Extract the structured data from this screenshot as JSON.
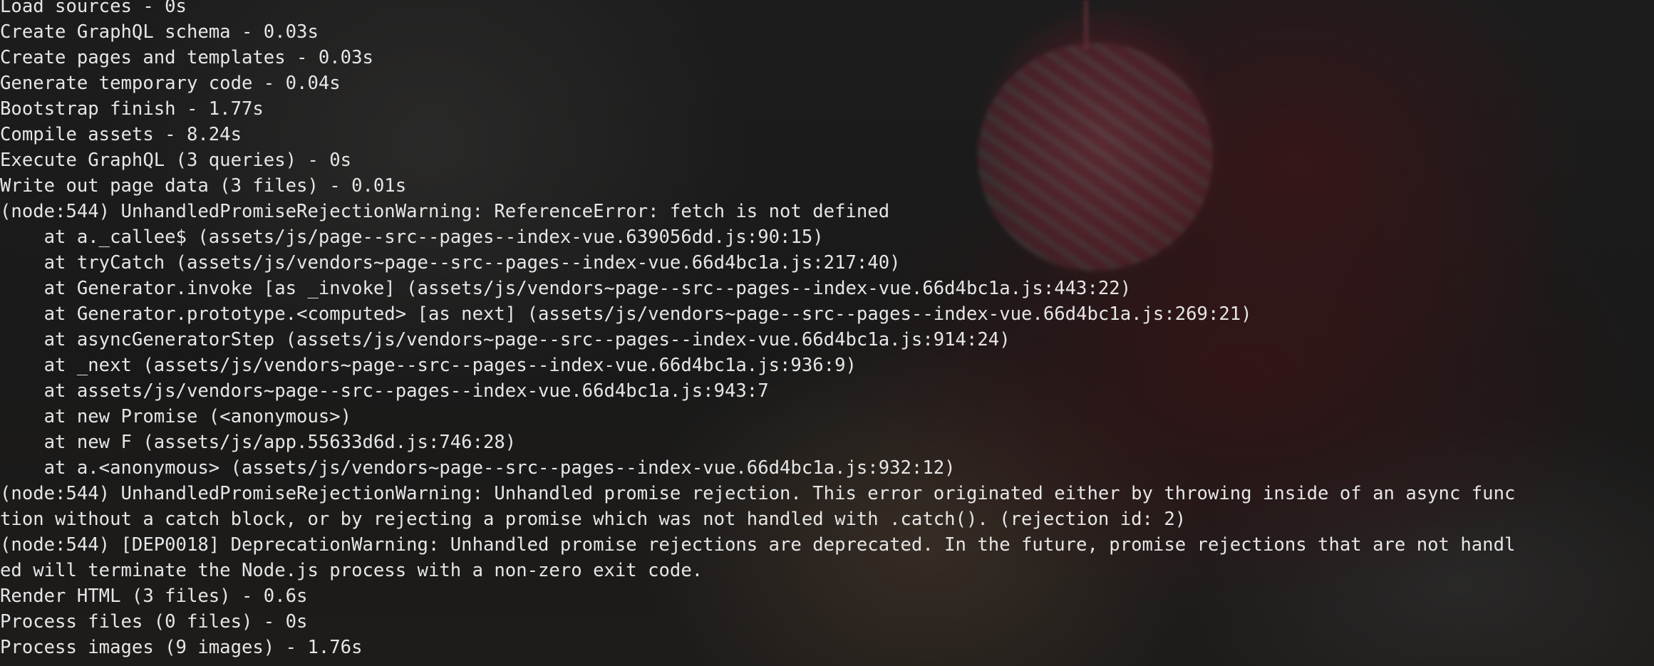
{
  "terminal": {
    "lines": [
      "Load sources - 0s",
      "Create GraphQL schema - 0.03s",
      "Create pages and templates - 0.03s",
      "Generate temporary code - 0.04s",
      "Bootstrap finish - 1.77s",
      "Compile assets - 8.24s",
      "Execute GraphQL (3 queries) - 0s",
      "Write out page data (3 files) - 0.01s",
      "(node:544) UnhandledPromiseRejectionWarning: ReferenceError: fetch is not defined",
      "    at a._callee$ (assets/js/page--src--pages--index-vue.639056dd.js:90:15)",
      "    at tryCatch (assets/js/vendors~page--src--pages--index-vue.66d4bc1a.js:217:40)",
      "    at Generator.invoke [as _invoke] (assets/js/vendors~page--src--pages--index-vue.66d4bc1a.js:443:22)",
      "    at Generator.prototype.<computed> [as next] (assets/js/vendors~page--src--pages--index-vue.66d4bc1a.js:269:21)",
      "    at asyncGeneratorStep (assets/js/vendors~page--src--pages--index-vue.66d4bc1a.js:914:24)",
      "    at _next (assets/js/vendors~page--src--pages--index-vue.66d4bc1a.js:936:9)",
      "    at assets/js/vendors~page--src--pages--index-vue.66d4bc1a.js:943:7",
      "    at new Promise (<anonymous>)",
      "    at new F (assets/js/app.55633d6d.js:746:28)",
      "    at a.<anonymous> (assets/js/vendors~page--src--pages--index-vue.66d4bc1a.js:932:12)",
      "(node:544) UnhandledPromiseRejectionWarning: Unhandled promise rejection. This error originated either by throwing inside of an async func",
      "tion without a catch block, or by rejecting a promise which was not handled with .catch(). (rejection id: 2)",
      "(node:544) [DEP0018] DeprecationWarning: Unhandled promise rejections are deprecated. In the future, promise rejections that are not handl",
      "ed will terminate the Node.js process with a non-zero exit code.",
      "Render HTML (3 files) - 0.6s",
      "Process files (0 files) - 0s",
      "Process images (9 images) - 1.76s"
    ]
  }
}
